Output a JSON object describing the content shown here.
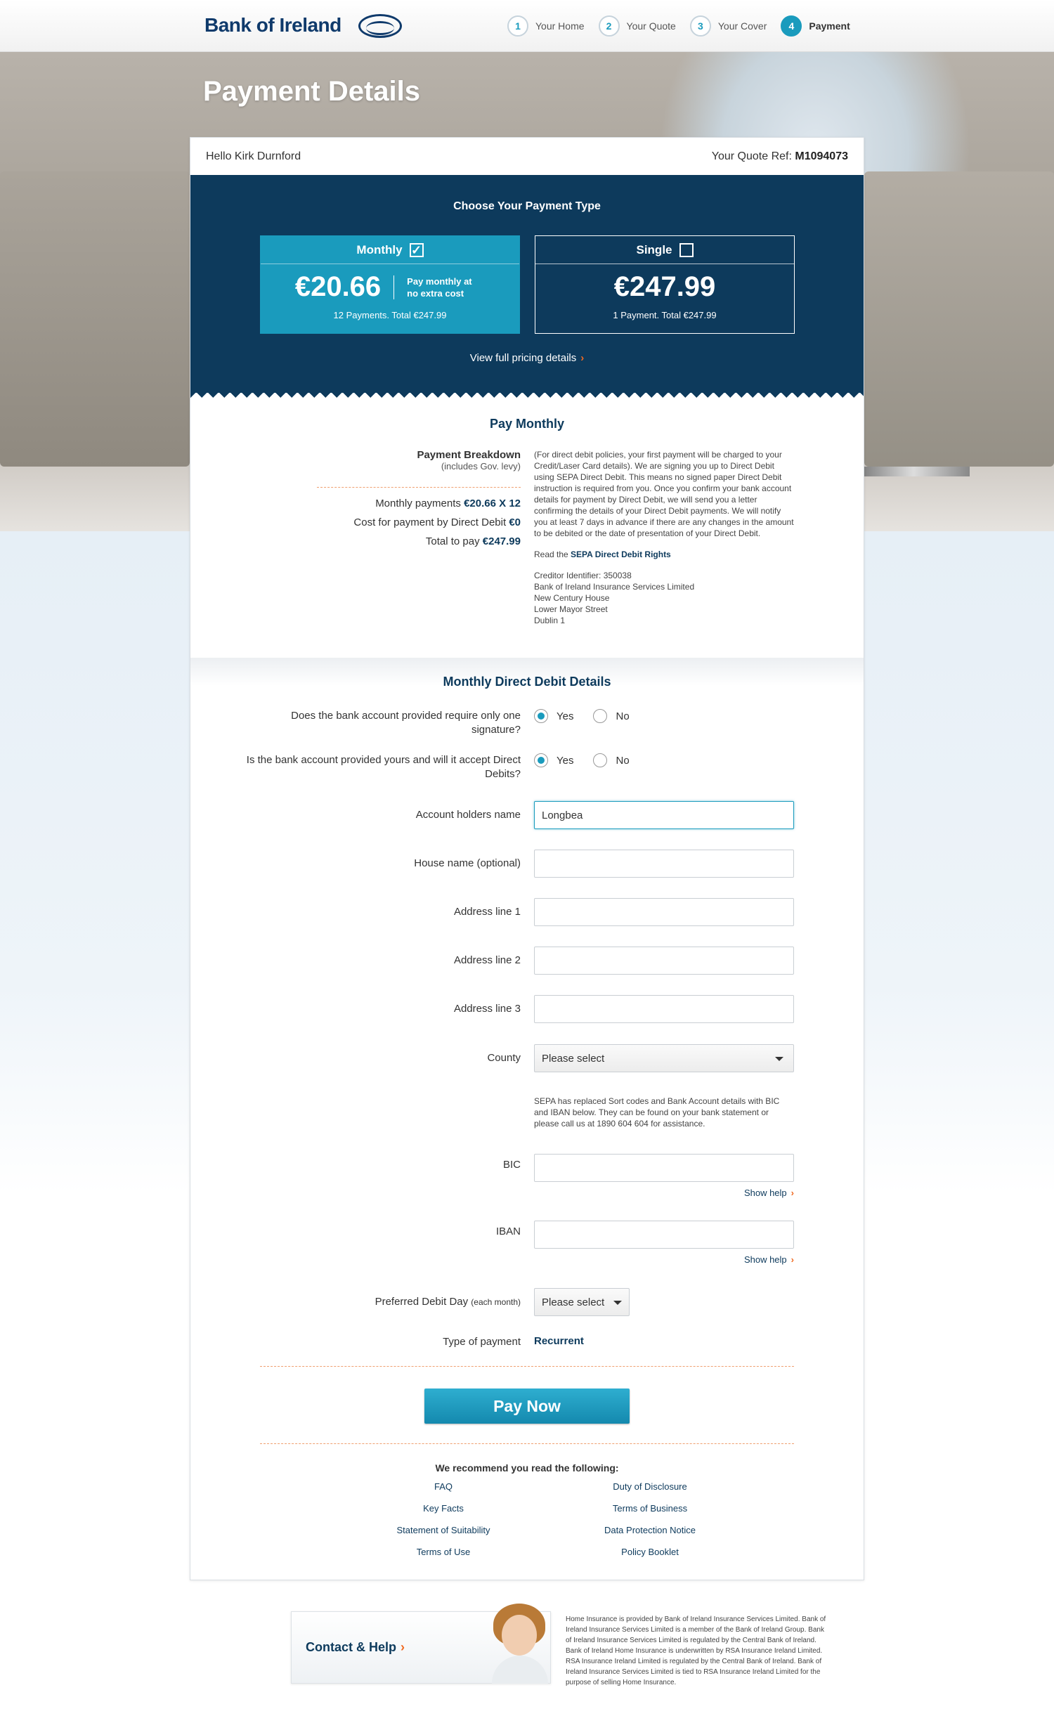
{
  "brand": {
    "name": "Bank of Ireland"
  },
  "steps": [
    {
      "num": "1",
      "label": "Your Home"
    },
    {
      "num": "2",
      "label": "Your Quote"
    },
    {
      "num": "3",
      "label": "Your Cover"
    },
    {
      "num": "4",
      "label": "Payment"
    }
  ],
  "page_title": "Payment Details",
  "greeting": "Hello Kirk Durnford",
  "quote_ref_label": "Your Quote Ref:",
  "quote_ref": "M1094073",
  "payment_type": {
    "heading": "Choose Your Payment Type",
    "monthly": {
      "label": "Monthly",
      "checked": true,
      "price": "€20.66",
      "note": "Pay monthly at no extra cost",
      "sub": "12 Payments. Total €247.99"
    },
    "single": {
      "label": "Single",
      "checked": false,
      "price": "€247.99",
      "sub": "1 Payment. Total €247.99"
    },
    "full_pricing_link": "View full pricing details"
  },
  "pay_monthly": {
    "title": "Pay Monthly",
    "breakdown_heading": "Payment Breakdown",
    "breakdown_sub": "(includes Gov. levy)",
    "rows": [
      {
        "label": "Monthly payments",
        "value": "€20.66 X 12"
      },
      {
        "label": "Cost for payment by Direct Debit",
        "value": "€0"
      },
      {
        "label": "Total to pay",
        "value": "€247.99"
      }
    ],
    "info": "(For direct debit policies, your first payment will be charged to your Credit/Laser Card details). We are signing you up to Direct Debit using SEPA Direct Debit. This means no signed paper Direct Debit instruction is required from you. Once you confirm your bank account details for payment by Direct Debit, we will send you a letter confirming the details of your Direct Debit payments. We will notify you at least 7 days in advance if there are any changes in the amount to be debited or the date of presentation of your Direct Debit.",
    "read_prefix": "Read the",
    "read_link": "SEPA Direct Debit Rights",
    "creditor_lines": [
      "Creditor Identifier: 350038",
      "Bank of Ireland Insurance Services Limited",
      "New Century House",
      "Lower Mayor Street",
      "Dublin 1"
    ]
  },
  "direct_debit": {
    "title": "Monthly Direct Debit Details",
    "q1": {
      "label": "Does the bank account provided require only one signature?",
      "yes": "Yes",
      "no": "No",
      "selected": "Yes"
    },
    "q2": {
      "label": "Is the bank account provided yours and will it accept Direct Debits?",
      "yes": "Yes",
      "no": "No",
      "selected": "Yes"
    },
    "account_holder": {
      "label": "Account holders name",
      "value": "Longbea"
    },
    "house_name": {
      "label": "House name (optional)",
      "value": ""
    },
    "address1": {
      "label": "Address line 1",
      "value": ""
    },
    "address2": {
      "label": "Address line 2",
      "value": ""
    },
    "address3": {
      "label": "Address line 3",
      "value": ""
    },
    "county": {
      "label": "County",
      "value": "Please select"
    },
    "sepa_note": "SEPA has replaced Sort codes and Bank Account details with BIC and IBAN below. They can be found on your bank statement or please call us at 1890 604 604 for assistance.",
    "bic": {
      "label": "BIC",
      "value": ""
    },
    "iban": {
      "label": "IBAN",
      "value": ""
    },
    "show_help": "Show help",
    "debit_day": {
      "label": "Preferred Debit Day",
      "label_small": "(each month)",
      "value": "Please select"
    },
    "payment_type": {
      "label": "Type of payment",
      "value": "Recurrent"
    }
  },
  "pay_now": "Pay Now",
  "recommend": {
    "title": "We recommend you read the following:",
    "left": [
      "FAQ",
      "Key Facts",
      "Statement of Suitability",
      "Terms of Use"
    ],
    "right": [
      "Duty of Disclosure",
      "Terms of Business",
      "Data Protection Notice",
      "Policy Booklet"
    ]
  },
  "contact": {
    "label": "Contact & Help"
  },
  "legal": "Home Insurance is provided by Bank of Ireland Insurance Services Limited. Bank of Ireland Insurance Services Limited is a member of the Bank of Ireland Group. Bank of Ireland Insurance Services Limited is regulated by the Central Bank of Ireland. Bank of Ireland Home Insurance is underwritten by RSA Insurance Ireland Limited. RSA Insurance Ireland Limited is regulated by the Central Bank of Ireland. Bank of Ireland Insurance Services Limited is tied to RSA Insurance Ireland Limited for the purpose of selling Home Insurance.",
  "colors": {
    "navy": "#0d3a5c",
    "teal": "#1a9bbd",
    "orange": "#f06a22"
  }
}
